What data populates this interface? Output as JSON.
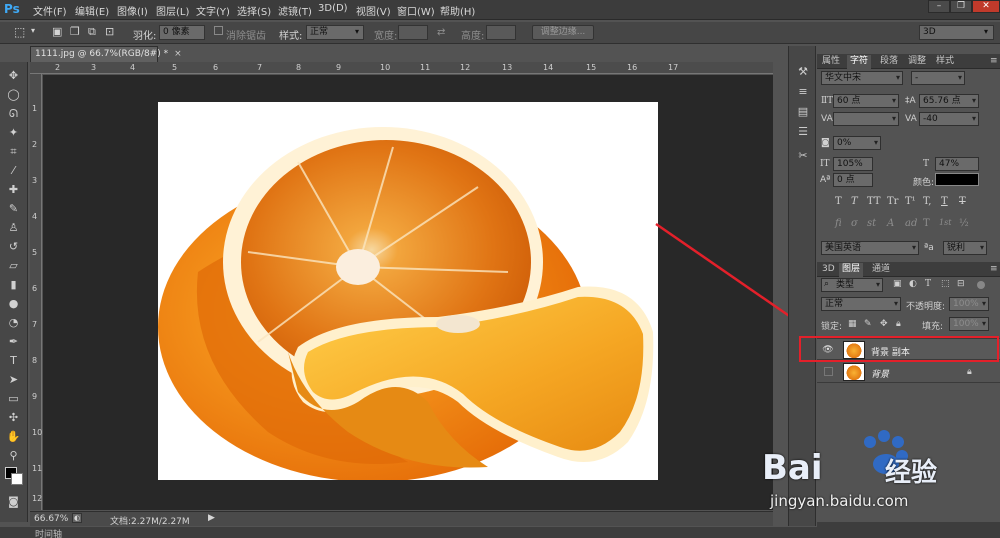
{
  "app": {
    "logo": "Ps"
  },
  "menu": [
    "文件(F)",
    "编辑(E)",
    "图像(I)",
    "图层(L)",
    "文字(Y)",
    "选择(S)",
    "滤镜(T)",
    "3D(D)",
    "视图(V)",
    "窗口(W)",
    "帮助(H)"
  ],
  "window_controls": {
    "minimize": "–",
    "restore": "❐",
    "close": "✕"
  },
  "options": {
    "feather_label": "羽化:",
    "feather_value": "0 像素",
    "antialias_label": "消除锯齿",
    "style_label": "样式:",
    "style_value": "正常",
    "width_label": "宽度:",
    "height_label": "高度:",
    "refine_edge": "调整边缘...",
    "workspace": "3D"
  },
  "document": {
    "tab_title": "1111.jpg @ 66.7%(RGB/8#) *",
    "close": "×"
  },
  "ruler": {
    "top": [
      "2",
      "3",
      "4",
      "5",
      "6",
      "7",
      "8",
      "9",
      "10",
      "11",
      "12",
      "13",
      "14",
      "15",
      "16",
      "17"
    ],
    "left": [
      "1",
      "2",
      "3",
      "4",
      "5",
      "6",
      "7",
      "8",
      "9",
      "10",
      "11",
      "12"
    ]
  },
  "status": {
    "zoom": "66.67%",
    "doc_info": "文档:2.27M/2.27M"
  },
  "timeline": "时间轴",
  "character_panel": {
    "tabs": [
      "属性",
      "字符",
      "段落",
      "调整",
      "样式"
    ],
    "font_family": "华文中宋",
    "font_style": "-",
    "font_size": "60 点",
    "leading": "65.76 点",
    "kerning_label": "VA",
    "tracking_label": "VA",
    "tracking": "-40",
    "scale_percent": "0%",
    "vertical_scale": "105%",
    "horizontal_scale": "47%",
    "baseline_shift": "0 点",
    "color_label": "颜色:",
    "glyphs_row1": [
      "T",
      "T",
      "TT",
      "Tr",
      "T¹",
      "T,",
      "T",
      "T"
    ],
    "glyphs_row2": [
      "fi",
      "σ",
      "st",
      "A",
      "ad",
      "T",
      "1st",
      "½"
    ],
    "language": "美国英语",
    "aa_label": "ªa",
    "antialias": "锐利"
  },
  "layers_panel": {
    "tabs": [
      "3D",
      "图层",
      "通道"
    ],
    "filter": "类型",
    "blend_mode": "正常",
    "opacity_label": "不透明度:",
    "opacity": "100%",
    "lock_label": "锁定:",
    "fill_label": "填充:",
    "fill": "100%",
    "layers": [
      {
        "name": "背景 副本",
        "visible": true,
        "highlighted": true
      },
      {
        "name": "背景",
        "visible": false,
        "locked": true
      }
    ]
  },
  "watermark": {
    "brand": "Bai",
    "brand_cn": "经验",
    "url": "jingyan.baidu.com"
  },
  "colors": {
    "highlight": "#e3202a",
    "accent": "#3fa9f5",
    "baidu_blue": "#2b6fd8"
  }
}
